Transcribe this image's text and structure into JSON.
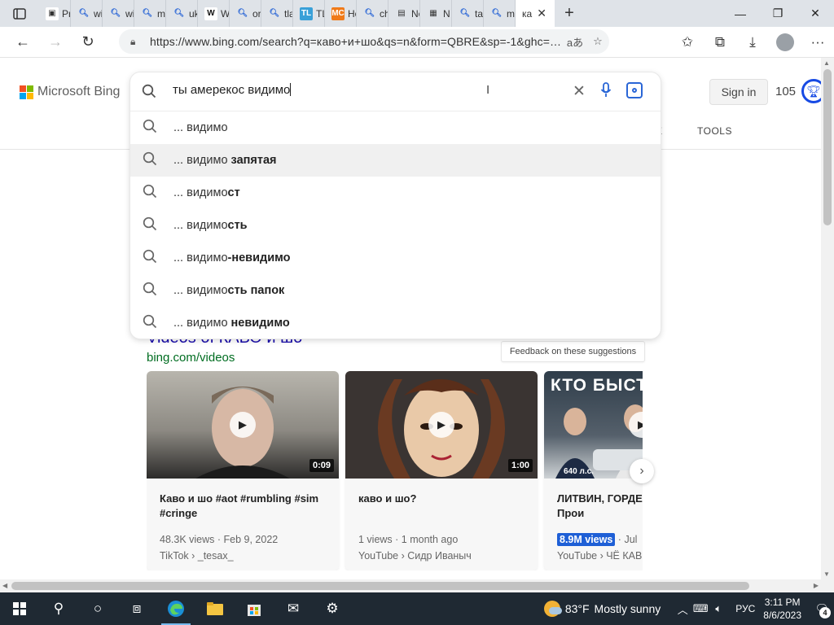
{
  "browser": {
    "tabs": [
      {
        "label": "Pr",
        "icon": "page-icon",
        "bg": "#ffffff",
        "fg": "#333333"
      },
      {
        "label": "wi",
        "icon": "bing-search-icon",
        "bg": "#dfe3e8",
        "fg": "#2a66d6"
      },
      {
        "label": "wi",
        "icon": "bing-search-icon",
        "bg": "#dfe3e8",
        "fg": "#2a66d6"
      },
      {
        "label": "m",
        "icon": "bing-search-icon",
        "bg": "#dfe3e8",
        "fg": "#2a66d6"
      },
      {
        "label": "uk",
        "icon": "bing-search-icon",
        "bg": "#dfe3e8",
        "fg": "#2a66d6"
      },
      {
        "label": "W",
        "icon": "wikipedia-icon",
        "bg": "#ffffff",
        "fg": "#111111"
      },
      {
        "label": "or",
        "icon": "bing-search-icon",
        "bg": "#dfe3e8",
        "fg": "#2a66d6"
      },
      {
        "label": "tla",
        "icon": "bing-search-icon",
        "bg": "#dfe3e8",
        "fg": "#2a66d6"
      },
      {
        "label": "TL",
        "icon": "tl-icon",
        "bg": "#39a0d8",
        "fg": "#ffffff"
      },
      {
        "label": "Ho",
        "icon": "mc-icon",
        "bg": "#f07a19",
        "fg": "#ffffff"
      },
      {
        "label": "ch",
        "icon": "bing-search-icon",
        "bg": "#dfe3e8",
        "fg": "#2a66d6"
      },
      {
        "label": "Nc",
        "icon": "news-icon",
        "bg": "#dfe3e8",
        "fg": "#333333"
      },
      {
        "label": "N",
        "icon": "microsoft-icon",
        "bg": "#dfe3e8",
        "fg": "#333333"
      },
      {
        "label": "ta",
        "icon": "bing-search-icon",
        "bg": "#dfe3e8",
        "fg": "#2a66d6"
      },
      {
        "label": "m",
        "icon": "bing-search-icon",
        "bg": "#dfe3e8",
        "fg": "#2a66d6"
      }
    ],
    "active_tab": {
      "label": "ка",
      "close": "✕"
    },
    "new_tab": "+",
    "window_controls": {
      "minimize": "—",
      "restore": "❐",
      "close": "✕"
    },
    "url": "https://www.bing.com/search?q=каво+и+шо&qs=n&form=QBRE&sp=-1&ghc=2..."
  },
  "bing": {
    "logo_text": "Microsoft Bing",
    "sign_in": "Sign in",
    "rewards_count": "105",
    "tools": "TOOLS",
    "hidden_nav_fragment": "E",
    "search": {
      "value": "ты амерекос видимо",
      "suggestions": [
        {
          "prefix": "... видимо",
          "bold": ""
        },
        {
          "prefix": "... видимо ",
          "bold": "запятая"
        },
        {
          "prefix": "... видимо",
          "bold": "ст"
        },
        {
          "prefix": "... видимо",
          "bold": "сть"
        },
        {
          "prefix": "... видимо",
          "bold": "-невидимо"
        },
        {
          "prefix": "... видимо",
          "bold": "сть папок"
        },
        {
          "prefix": "... видимо ",
          "bold": "невидимо"
        }
      ],
      "feedback": "Feedback on these suggestions"
    },
    "videos": {
      "heading": "Videos of КАВО и шо",
      "source": "bing.com/videos",
      "cards": [
        {
          "title": "Каво и шо #aot #rumbling #sim #cringe",
          "duration": "0:09",
          "views": "48.3K views",
          "date": "Feb 9, 2022",
          "channel": "TikTok › _tesax_",
          "thumb_color": "#8d8a83"
        },
        {
          "title": "каво и шо?",
          "duration": "1:00",
          "views": "1 views",
          "date": "1 month ago",
          "channel": "YouTube › Сидр Иваныч",
          "thumb_color": "#3a3432"
        },
        {
          "title": "ЛИТВИН, ГОРДЕЙ НА ТРЕКЕ! Прои",
          "duration": "",
          "views": "8.9M views",
          "date": "Jul",
          "channel": "YouTube › ЧЁ КАВ",
          "thumb_color": "#2f3d4a",
          "thumb_text": "КТО БЫСТ",
          "thumb_badge": "640 л.с."
        }
      ]
    }
  },
  "taskbar": {
    "weather_temp": "83°F",
    "weather_text": "Mostly sunny",
    "language": "РУС",
    "time": "3:11 PM",
    "date": "8/6/2023",
    "notifications": "4"
  }
}
